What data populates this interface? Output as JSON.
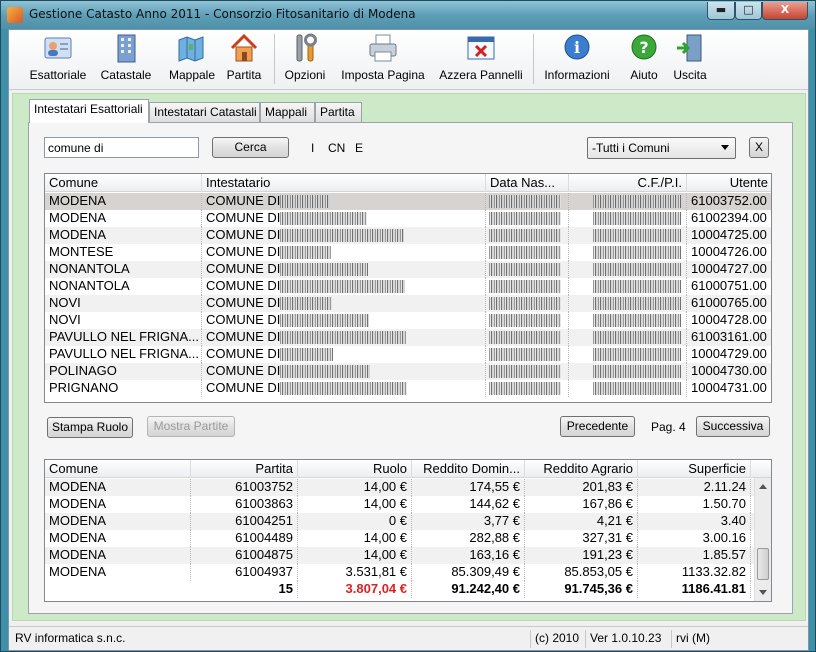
{
  "window": {
    "title": "Gestione Catasto Anno 2011 - Consorzio Fitosanitario di Modena",
    "min": "▬",
    "max": "□",
    "close": "X"
  },
  "toolbar": {
    "items": [
      {
        "label": "Esattoriale",
        "icon": "id-card-icon"
      },
      {
        "label": "Catastale",
        "icon": "building-icon"
      },
      {
        "label": "Mappale",
        "icon": "maps-icon"
      },
      {
        "label": "Partita",
        "icon": "house-icon"
      },
      {
        "label": "Opzioni",
        "icon": "tools-icon"
      },
      {
        "label": "Imposta Pagina",
        "icon": "printer-icon"
      },
      {
        "label": "Azzera Pannelli",
        "icon": "reset-window-icon"
      },
      {
        "label": "Informazioni",
        "icon": "info-icon"
      },
      {
        "label": "Aiuto",
        "icon": "help-icon"
      },
      {
        "label": "Uscita",
        "icon": "exit-icon"
      }
    ]
  },
  "tabs": [
    "Intestatari Esattoriali",
    "Intestatari Catastali",
    "Mappali",
    "Partita"
  ],
  "search": {
    "value": "comune di",
    "button": "Cerca",
    "flags": [
      "I",
      "CN",
      "E"
    ],
    "comuni_select": "-Tutti i Comuni",
    "clear_button": "X"
  },
  "top_grid": {
    "columns": [
      "Comune",
      "Intestatario",
      "Data Nas...",
      "C.F./P.I.",
      "Utente"
    ],
    "rows": [
      {
        "comune": "MODENA",
        "intestatario": "COMUNE DI",
        "utente": "61003752.00"
      },
      {
        "comune": "MODENA",
        "intestatario": "COMUNE DI",
        "utente": "61002394.00"
      },
      {
        "comune": "MODENA",
        "intestatario": "COMUNE DI",
        "utente": "10004725.00"
      },
      {
        "comune": "MONTESE",
        "intestatario": "COMUNE DI",
        "utente": "10004726.00"
      },
      {
        "comune": "NONANTOLA",
        "intestatario": "COMUNE DI",
        "utente": "10004727.00"
      },
      {
        "comune": "NONANTOLA",
        "intestatario": "COMUNE DI",
        "utente": "61000751.00"
      },
      {
        "comune": "NOVI",
        "intestatario": "COMUNE DI",
        "utente": "61000765.00"
      },
      {
        "comune": "NOVI",
        "intestatario": "COMUNE DI",
        "utente": "10004728.00"
      },
      {
        "comune": "PAVULLO NEL FRIGNA...",
        "intestatario": "COMUNE DI",
        "utente": "61003161.00"
      },
      {
        "comune": "PAVULLO NEL FRIGNA...",
        "intestatario": "COMUNE DI",
        "utente": "10004729.00"
      },
      {
        "comune": "POLINAGO",
        "intestatario": "COMUNE DI",
        "utente": "10004730.00"
      },
      {
        "comune": "PRIGNANO",
        "intestatario": "COMUNE DI",
        "utente": "10004731.00"
      }
    ]
  },
  "mid": {
    "stampa_ruolo": "Stampa Ruolo",
    "mostra_partite": "Mostra Partite",
    "precedente": "Precedente",
    "page": "Pag. 4",
    "successiva": "Successiva"
  },
  "bottom_grid": {
    "columns": [
      "Comune",
      "Partita",
      "Ruolo",
      "Reddito Domin...",
      "Reddito Agrario",
      "Superficie"
    ],
    "rows": [
      {
        "comune": "MODENA",
        "partita": "61003752",
        "ruolo": "14,00 €",
        "dom": "174,55 €",
        "agr": "201,83 €",
        "sup": "2.11.24"
      },
      {
        "comune": "MODENA",
        "partita": "61003863",
        "ruolo": "14,00 €",
        "dom": "144,62 €",
        "agr": "167,86 €",
        "sup": "1.50.70"
      },
      {
        "comune": "MODENA",
        "partita": "61004251",
        "ruolo": "0 €",
        "dom": "3,77 €",
        "agr": "4,21 €",
        "sup": "3.40"
      },
      {
        "comune": "MODENA",
        "partita": "61004489",
        "ruolo": "14,00 €",
        "dom": "282,88 €",
        "agr": "327,31 €",
        "sup": "3.00.16"
      },
      {
        "comune": "MODENA",
        "partita": "61004875",
        "ruolo": "14,00 €",
        "dom": "163,16 €",
        "agr": "191,23 €",
        "sup": "1.85.57"
      },
      {
        "comune": "MODENA",
        "partita": "61004937",
        "ruolo": "3.531,81 €",
        "dom": "85.309,49 €",
        "agr": "85.853,05 €",
        "sup": "1133.32.82"
      }
    ],
    "totals": {
      "partita": "15",
      "ruolo": "3.807,04 €",
      "dom": "91.242,40 €",
      "agr": "91.745,36 €",
      "sup": "1186.41.81"
    },
    "totals_color": "#e02020"
  },
  "status": {
    "company": "RV informatica s.n.c.",
    "copyright": "(c) 2010",
    "version": "Ver 1.0.10.23",
    "mode": "rvi (M)"
  }
}
